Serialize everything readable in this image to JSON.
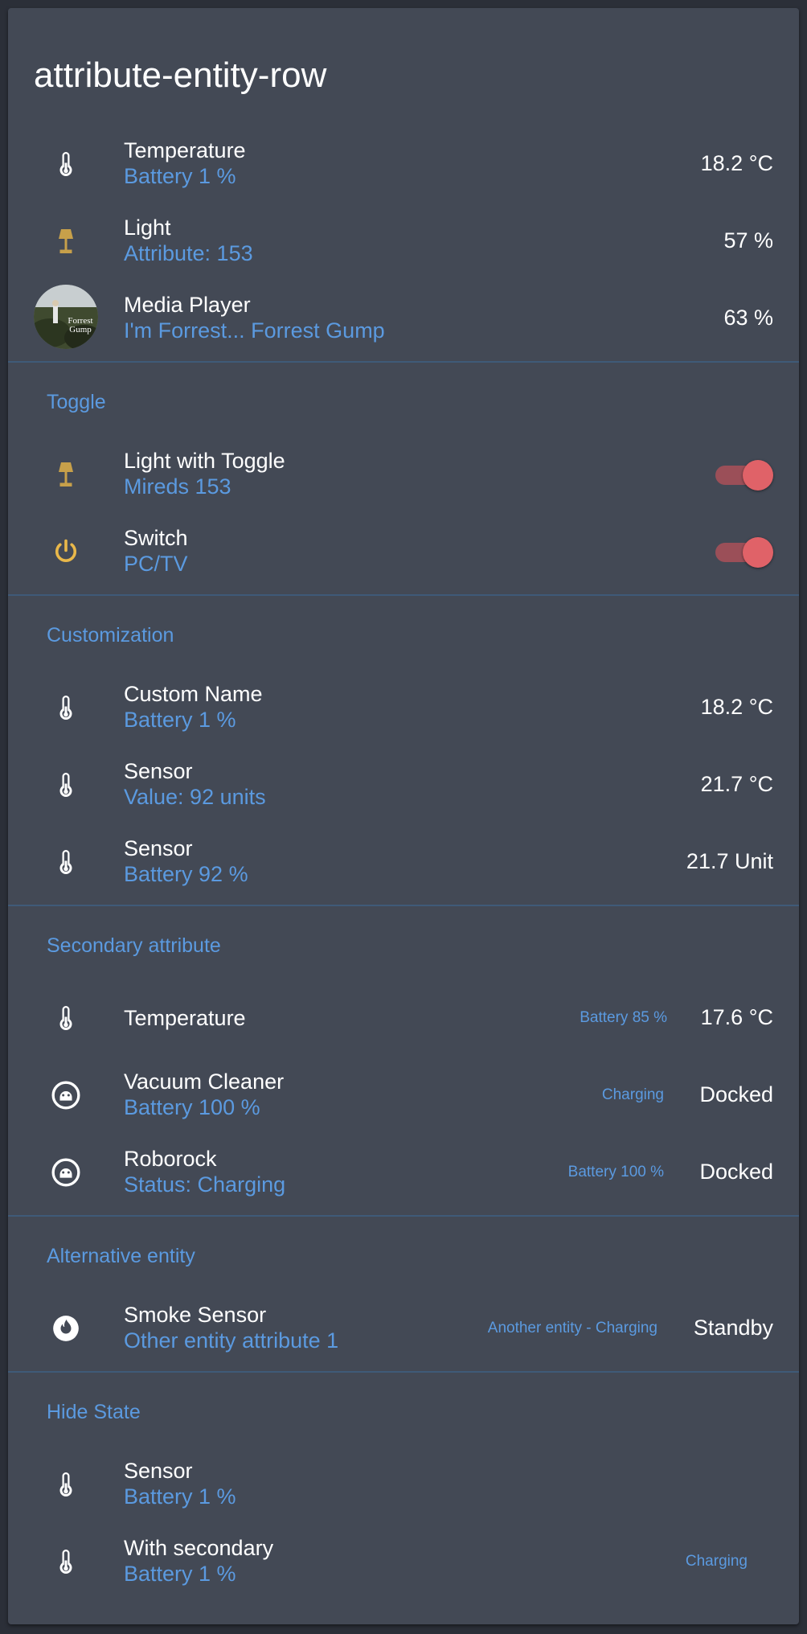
{
  "card": {
    "title": "attribute-entity-row"
  },
  "colors": {
    "accent": "#5b9ae0",
    "lamp": "#c7a04a",
    "power": "#e9b84a",
    "toggle": "#e06268"
  },
  "top": [
    {
      "name": "Temperature",
      "sub": "Battery 1 %",
      "state": "18.2 °C",
      "icon": "thermometer-icon"
    },
    {
      "name": "Light",
      "sub": "Attribute: 153",
      "state": "57 %",
      "icon": "lamp-icon"
    },
    {
      "name": "Media Player",
      "sub": "I'm Forrest... Forrest Gump",
      "state": "63 %",
      "icon": "album-art"
    }
  ],
  "toggle_section": {
    "title": "Toggle",
    "rows": [
      {
        "name": "Light with Toggle",
        "sub": "Mireds 153",
        "icon": "lamp-icon",
        "on": true
      },
      {
        "name": "Switch",
        "sub": "PC/TV",
        "icon": "power-icon",
        "on": true
      }
    ]
  },
  "custom_section": {
    "title": "Customization",
    "rows": [
      {
        "name": "Custom Name",
        "sub": "Battery 1 %",
        "state": "18.2 °C"
      },
      {
        "name": "Sensor",
        "sub": "Value: 92 units",
        "state": "21.7 °C"
      },
      {
        "name": "Sensor",
        "sub": "Battery 92 %",
        "state": "21.7 Unit"
      }
    ]
  },
  "secondary_section": {
    "title": "Secondary attribute",
    "rows": [
      {
        "name": "Temperature",
        "secondary": "Battery 85 %",
        "state": "17.6 °C",
        "icon": "thermometer-icon"
      },
      {
        "name": "Vacuum Cleaner",
        "sub": "Battery 100 %",
        "secondary": "Charging",
        "state": "Docked",
        "icon": "robot-vacuum-icon"
      },
      {
        "name": "Roborock",
        "sub": "Status: Charging",
        "secondary": "Battery 100 %",
        "state": "Docked",
        "icon": "robot-vacuum-icon"
      }
    ]
  },
  "alt_section": {
    "title": "Alternative entity",
    "rows": [
      {
        "name": "Smoke Sensor",
        "sub": "Other entity attribute 1",
        "secondary": "Another entity - Charging",
        "state": "Standby",
        "icon": "fire-icon"
      }
    ]
  },
  "hide_section": {
    "title": "Hide State",
    "rows": [
      {
        "name": "Sensor",
        "sub": "Battery 1 %",
        "icon": "thermometer-icon"
      },
      {
        "name": "With secondary",
        "sub": "Battery 1 %",
        "secondary": "Charging",
        "icon": "thermometer-icon"
      }
    ]
  }
}
